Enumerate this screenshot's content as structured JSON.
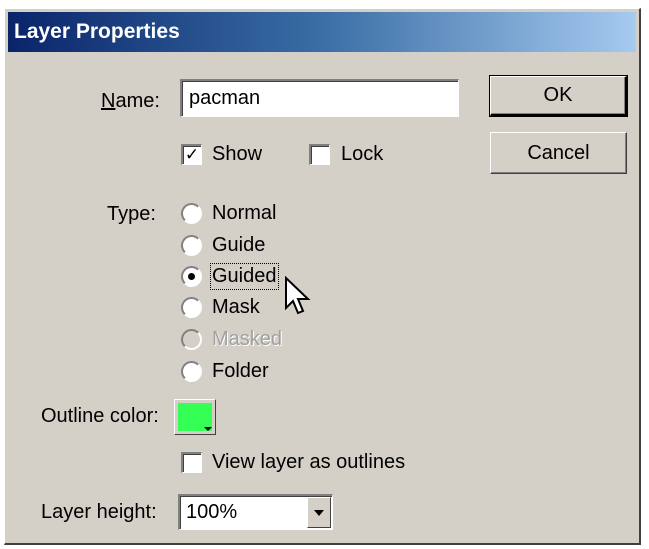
{
  "window": {
    "title": "Layer Properties"
  },
  "name_field": {
    "label_prefix": "N",
    "label_rest": "ame:",
    "value": "pacman"
  },
  "buttons": {
    "ok": "OK",
    "cancel": "Cancel"
  },
  "checkboxes": {
    "show": {
      "label": "Show",
      "checked": true
    },
    "lock": {
      "label": "Lock",
      "checked": false
    }
  },
  "type": {
    "label": "Type:",
    "options": [
      {
        "label": "Normal",
        "selected": false,
        "enabled": true
      },
      {
        "label": "Guide",
        "selected": false,
        "enabled": true
      },
      {
        "label": "Guided",
        "selected": true,
        "enabled": true
      },
      {
        "label": "Mask",
        "selected": false,
        "enabled": true
      },
      {
        "label": "Masked",
        "selected": false,
        "enabled": false
      },
      {
        "label": "Folder",
        "selected": false,
        "enabled": true
      }
    ]
  },
  "outline_color": {
    "label": "Outline color:",
    "color": "#33ff55"
  },
  "view_outlines": {
    "label": "View layer as outlines",
    "checked": false
  },
  "layer_height": {
    "label": "Layer height:",
    "value": "100%"
  },
  "icons": {
    "cursor": "arrow-cursor-icon",
    "dropdown": "chevron-down-icon"
  }
}
